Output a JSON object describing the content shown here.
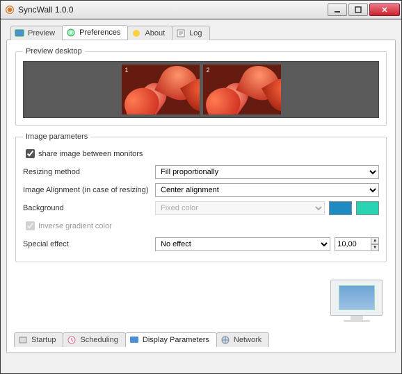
{
  "titlebar": {
    "title": "SyncWall 1.0.0"
  },
  "tabs_top": {
    "preview": "Preview",
    "preferences": "Preferences",
    "about": "About",
    "log": "Log"
  },
  "preview_group": {
    "legend": "Preview desktop",
    "mon1": "1",
    "mon2": "2"
  },
  "params_group": {
    "legend": "Image parameters",
    "share_label": "share image between monitors",
    "resizing_label": "Resizing method",
    "resizing_value": "Fill proportionally",
    "align_label": "Image Alignment (in case of resizing)",
    "align_value": "Center alignment",
    "bg_label": "Background",
    "bg_value": "Fixed color",
    "inverse_label": "Inverse gradient color",
    "effect_label": "Special effect",
    "effect_value": "No effect",
    "spin_value": "10,00",
    "swatch1": "#1e8bc3",
    "swatch2": "#29d4b4"
  },
  "tabs_bottom": {
    "startup": "Startup",
    "scheduling": "Scheduling",
    "display_params": "Display Parameters",
    "network": "Network"
  }
}
